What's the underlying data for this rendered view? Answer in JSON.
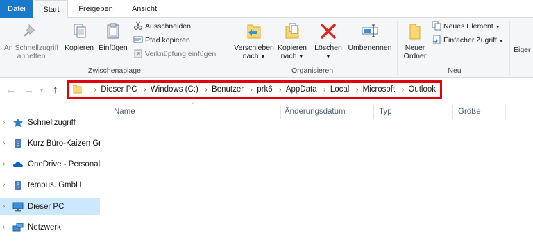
{
  "tabs": [
    "Datei",
    "Start",
    "Freigeben",
    "Ansicht"
  ],
  "ribbon": {
    "clipboard": {
      "pin_label": "An Schnellzugriff anheften",
      "pin_line1": "An Schnellzugriff",
      "pin_line2": "anheften",
      "copy_label": "Kopieren",
      "paste_label": "Einfügen",
      "cut_label": "Ausschneiden",
      "copy_path_label": "Pfad kopieren",
      "paste_shortcut_label": "Verknüpfung einfügen",
      "group_label": "Zwischenablage"
    },
    "organize": {
      "move_line1": "Verschieben",
      "move_line2": "nach",
      "copyto_line1": "Kopieren",
      "copyto_line2": "nach",
      "delete_label": "Löschen",
      "rename_label": "Umbenennen",
      "group_label": "Organisieren"
    },
    "new": {
      "newfolder_line1": "Neuer",
      "newfolder_line2": "Ordner",
      "new_item_label": "Neues Element",
      "easy_access_label": "Einfacher Zugriff",
      "group_label": "Neu"
    },
    "properties_partial": "Eiger"
  },
  "address": {
    "crumbs": [
      "Dieser PC",
      "Windows (C:)",
      "Benutzer",
      "prk6",
      "AppData",
      "Local",
      "Microsoft",
      "Outlook"
    ],
    "highlight_color": "#e3000b"
  },
  "columns": [
    "Name",
    "Änderungsdatum",
    "Typ",
    "Größe"
  ],
  "nav_pane": [
    {
      "label": "Schnellzugriff",
      "icon": "star-icon"
    },
    {
      "label": "Kurz Büro-Kaizen Gm",
      "icon": "building-icon"
    },
    {
      "label": "OneDrive - Personal",
      "icon": "cloud-icon"
    },
    {
      "label": "tempus. GmbH",
      "icon": "building-icon"
    },
    {
      "label": "Dieser PC",
      "icon": "monitor-icon",
      "selected": true
    },
    {
      "label": "Netzwerk",
      "icon": "network-icon"
    }
  ],
  "colors": {
    "accent": "#1979ca",
    "selection": "#cce8ff"
  }
}
